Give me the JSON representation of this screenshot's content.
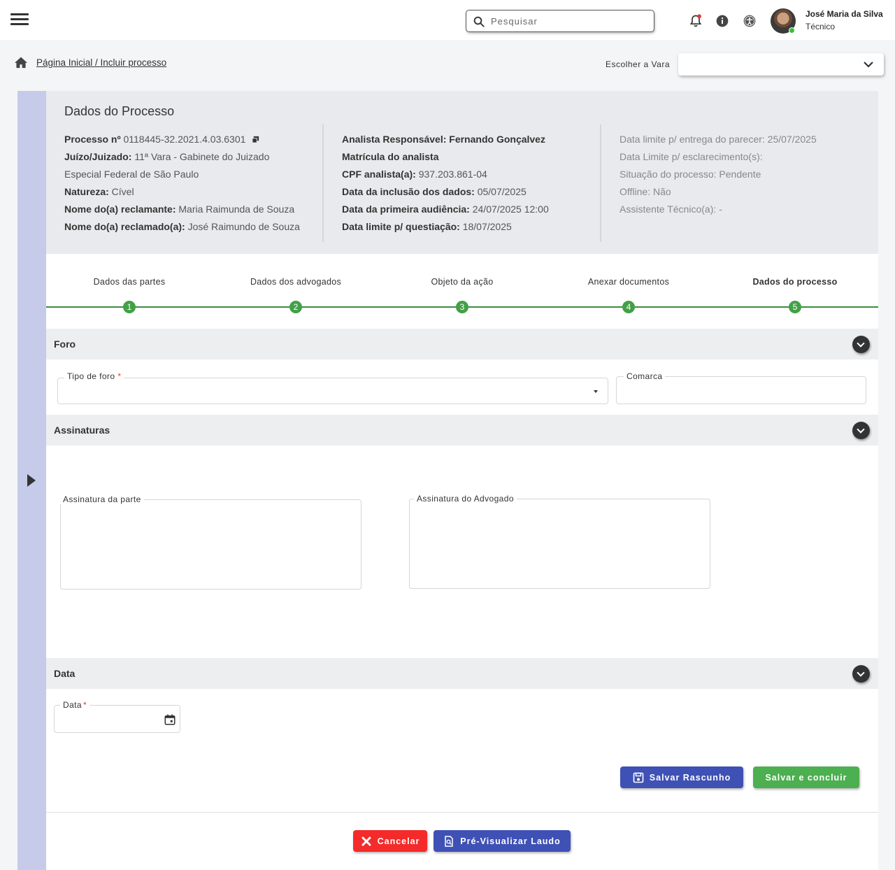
{
  "header": {
    "search_placeholder": "Pesquisar",
    "user_name": "José Maria da Silva",
    "user_role": "Técnico",
    "icons": [
      "menu-icon",
      "search-icon",
      "bell-icon",
      "info-icon",
      "accessibility-icon"
    ]
  },
  "breadcrumb": "Página Inicial / Incluir processo",
  "vara": {
    "label": "Escolher a Vara",
    "value": ""
  },
  "summary": {
    "title": "Dados do Processo",
    "col1": [
      {
        "k": "Processo nº",
        "v": " 0118445-32.2021.4.03.6301"
      },
      {
        "k": "Juízo/Juizado:",
        "v": " 11ª Vara - Gabinete do Juizado"
      },
      {
        "k": "",
        "v": "Especial Federal de São Paulo"
      },
      {
        "k": "Natureza:",
        "v": " Cível"
      },
      {
        "k": "Nome do(a) reclamante:",
        "v": " Maria Raimunda de Souza"
      },
      {
        "k": "Nome do(a) reclamado(a):",
        "v": " José Raimundo de Souza"
      }
    ],
    "col2": [
      {
        "k": "Analista Responsável: Fernando Gonçalvez",
        "v": ""
      },
      {
        "k": "Matrícula do analista",
        "v": ""
      },
      {
        "k": "CPF analista(a):",
        "v": " 937.203.861-04"
      },
      {
        "k": "Data da inclusão dos dados:",
        "v": " 05/07/2025"
      },
      {
        "k": "Data da primeira audiência:",
        "v": " 24/07/2025  12:00"
      },
      {
        "k": "Data limite p/ questiação:",
        "v": " 18/07/2025"
      }
    ],
    "col3": [
      {
        "k": "Data limite p/ entrega do parecer:",
        "v": " 25/07/2025"
      },
      {
        "k": "Data Limite p/ esclarecimento(s):",
        "v": ""
      },
      {
        "k": "Situação do processo:",
        "v": " Pendente"
      },
      {
        "k": "Offline:",
        "v": " Não"
      },
      {
        "k": "Assistente Técnico(a):",
        "v": " -"
      }
    ]
  },
  "steps": [
    {
      "label": "Dados das partes",
      "num": "1"
    },
    {
      "label": "Dados dos advogados",
      "num": "2"
    },
    {
      "label": "Objeto da ação",
      "num": "3"
    },
    {
      "label": "Anexar documentos",
      "num": "4"
    },
    {
      "label": "Dados do processo",
      "num": "5"
    }
  ],
  "sections": {
    "foro": {
      "title": "Foro",
      "tipo_label": "Tipo de foro",
      "required_mark": "*",
      "comarca_label": "Comarca"
    },
    "assinaturas": {
      "title": "Assinaturas",
      "parte_label": "Assinatura da parte",
      "advogado_label": "Assinatura do Advogado"
    },
    "data": {
      "title": "Data",
      "data_label": "Data",
      "required_mark": "*"
    }
  },
  "buttons": {
    "salvar_rascunho": "Salvar Rascunho",
    "salvar_concluir": "Salvar e concluir",
    "cancelar": "Cancelar",
    "pre_visualizar": "Pré-Visualizar Laudo"
  },
  "colors": {
    "accent_blue": "#3f51b5",
    "success_green": "#4caf50",
    "danger_red": "#f52a2a",
    "rail": "#c5cbe8"
  }
}
